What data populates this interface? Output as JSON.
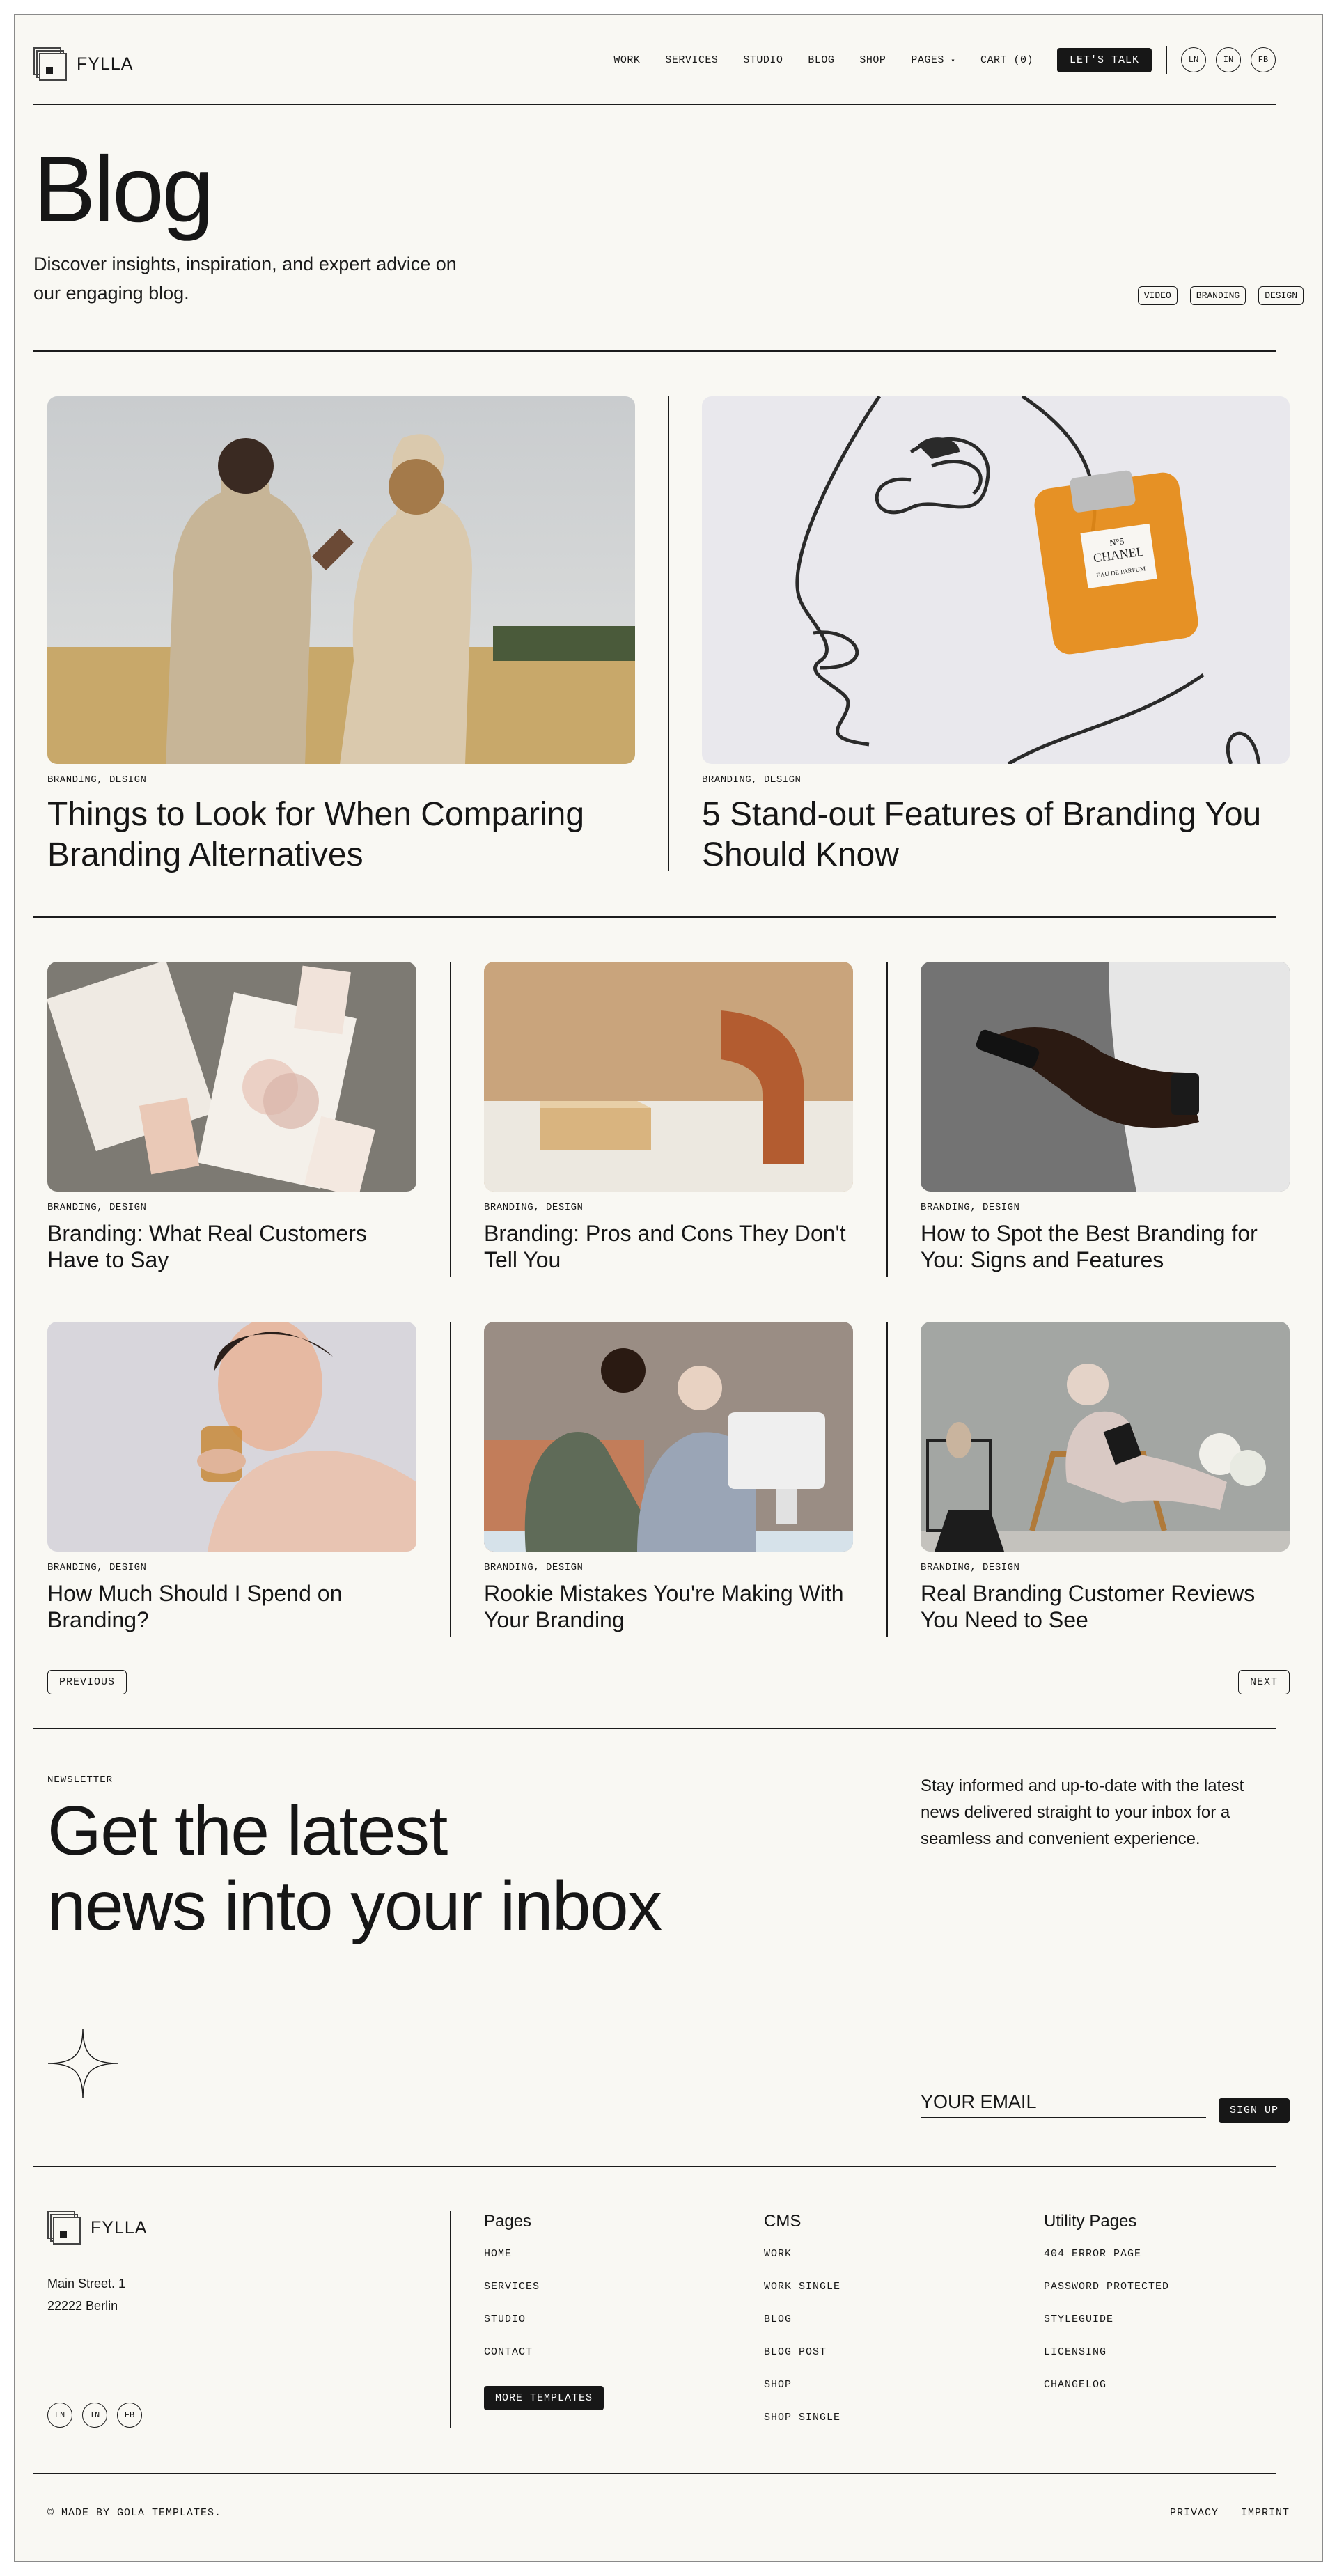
{
  "brand": {
    "name": "FYLLA"
  },
  "nav": {
    "items": [
      "WORK",
      "SERVICES",
      "STUDIO",
      "BLOG",
      "SHOP",
      "PAGES"
    ],
    "cart": "CART (0)",
    "cta": "LET'S TALK",
    "social": [
      "LN",
      "IN",
      "FB"
    ]
  },
  "hero": {
    "title": "Blog",
    "subtitle": "Discover insights, inspiration, and expert advice on our engaging blog.",
    "tags": [
      "VIDEO",
      "BRANDING",
      "DESIGN"
    ]
  },
  "featured": [
    {
      "category": "BRANDING, DESIGN",
      "title": "Things to Look for When Comparing Branding Alternatives"
    },
    {
      "category": "BRANDING, DESIGN",
      "title": "5 Stand-out Features of Branding You Should Know",
      "label": "N°5 CHANEL PARIS EAU DE PARFUM"
    }
  ],
  "posts": [
    {
      "category": "BRANDING, DESIGN",
      "title": "Branding: What Real Customers Have to Say"
    },
    {
      "category": "BRANDING, DESIGN",
      "title": "Branding: Pros and Cons They Don't Tell You"
    },
    {
      "category": "BRANDING, DESIGN",
      "title": "How to Spot the Best Branding for You: Signs and Features"
    },
    {
      "category": "BRANDING, DESIGN",
      "title": "How Much Should I Spend on Branding?"
    },
    {
      "category": "BRANDING, DESIGN",
      "title": "Rookie Mistakes You're Making With Your Branding"
    },
    {
      "category": "BRANDING, DESIGN",
      "title": "Real Branding Customer Reviews You Need to See"
    }
  ],
  "pagination": {
    "prev": "PREVIOUS",
    "next": "NEXT"
  },
  "newsletter": {
    "kicker": "NEWSLETTER",
    "headline_1": "Get the latest",
    "headline_2": "news into your inbox",
    "description": "Stay informed and up-to-date with the latest news delivered straight to your inbox for a seamless and convenient experience.",
    "email_placeholder": "YOUR EMAIL",
    "button": "SIGN UP"
  },
  "footer": {
    "address_1": "Main Street. 1",
    "address_2": "22222 Berlin",
    "social": [
      "LN",
      "IN",
      "FB"
    ],
    "columns": [
      {
        "heading": "Pages",
        "links": [
          "HOME",
          "SERVICES",
          "STUDIO",
          "CONTACT"
        ]
      },
      {
        "heading": "CMS",
        "links": [
          "WORK",
          "WORK SINGLE",
          "BLOG",
          "BLOG POST",
          "SHOP",
          "SHOP SINGLE"
        ]
      },
      {
        "heading": "Utility Pages",
        "links": [
          "404 ERROR PAGE",
          "PASSWORD PROTECTED",
          "STYLEGUIDE",
          "LICENSING",
          "CHANGELOG"
        ]
      }
    ],
    "more_templates": "MORE TEMPLATES",
    "copyright": "© MADE BY GOLA TEMPLATES.",
    "legal": [
      "PRIVACY",
      "IMPRINT"
    ]
  }
}
